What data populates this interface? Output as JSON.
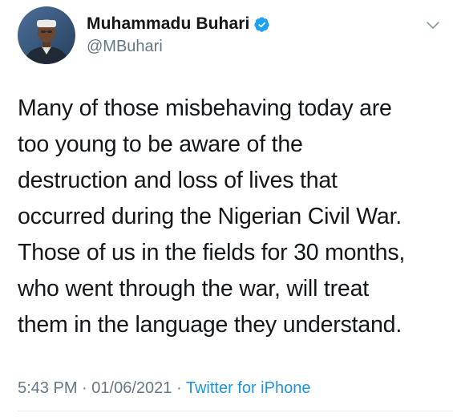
{
  "user": {
    "display_name": "Muhammadu Buhari",
    "handle": "@MBuhari",
    "verified": true,
    "avatar_icon": "profile-photo"
  },
  "tweet": {
    "text": "Many of those misbehaving today are\ntoo young to be aware of the\ndestruction and loss of lives that\noccurred during the Nigerian Civil War.\nThose of us in the fields for 30 months,\nwho went through the war, will treat\nthem in the language they understand."
  },
  "meta": {
    "time": "5:43 PM",
    "separator": "·",
    "date": "01/06/2021",
    "source": "Twitter for iPhone"
  },
  "icons": {
    "verified": "verified-badge-icon",
    "menu": "chevron-down-icon"
  },
  "colors": {
    "verified": "#1da1f2",
    "link": "#1b95e0",
    "secondary_text": "#657786",
    "primary_text": "#14171a"
  }
}
